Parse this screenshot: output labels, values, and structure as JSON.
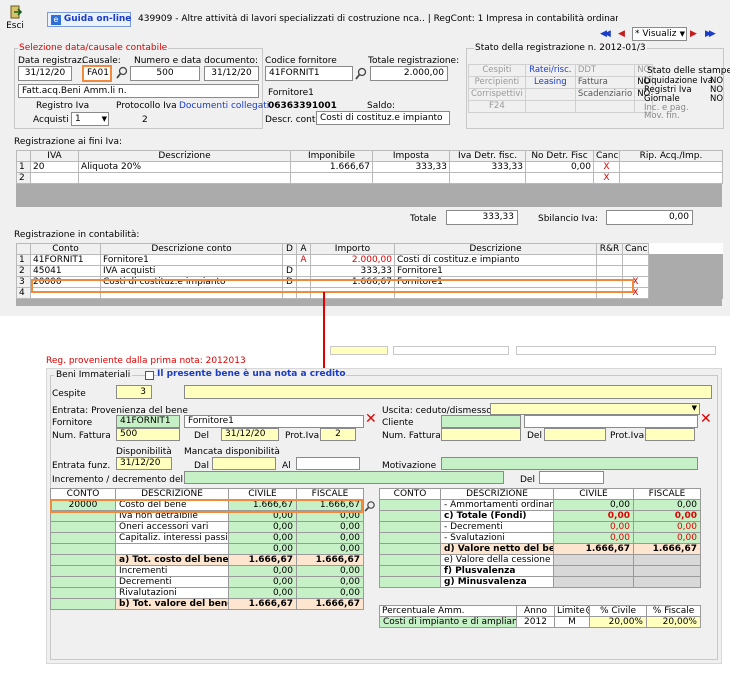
{
  "toolbar": {
    "esci": "Esci",
    "guida": "Guida on-line",
    "title": "439909 - Altre attività di lavori specializzati di costruzione nca.. | RegCont: 1 Impresa  in contabilità ordinaria..",
    "visualizza": "* Visualiz"
  },
  "selezione": {
    "legend": "Selezione data/causale contabile",
    "data_label": "Data registraz.",
    "causale_label": "Causale:",
    "numero_label": "Numero e data documento:",
    "data": "31/12/20",
    "causale": "FA01",
    "numero": "500",
    "data_doc": "31/12/20",
    "descrizione": "Fatt.acq.Beni Amm.li n.",
    "registro_label": "Registro Iva",
    "protocollo_label": "Protocollo Iva",
    "documenti_link": "Documenti collegati",
    "registro": "Acquisti",
    "registro_num": "1",
    "protocollo": "2"
  },
  "fornitore": {
    "codice_label": "Codice fornitore",
    "totale_label": "Totale registrazione:",
    "codice": "41FORNIT1",
    "totale": "2.000,00",
    "nome": "Fornitore1",
    "piva": "06363391001",
    "saldo_label": "Saldo:",
    "descr_label": "Descr. conto",
    "descr": "Costi di costituz.e impianto"
  },
  "stato": {
    "legend": "Stato della registrazione n. 2012-01/3",
    "rows": [
      [
        "Cespiti",
        "Ratei/risc.",
        "DDT",
        "NO"
      ],
      [
        "Percipienti",
        "Leasing",
        "Fattura",
        "NO"
      ],
      [
        "Corrispettivi",
        "",
        "Scadenziario",
        "NO"
      ],
      [
        "F24",
        "",
        "",
        ""
      ]
    ],
    "stampe_title": "Stato delle stampe:",
    "stampe": [
      [
        "Liquidazione Iva",
        "NO"
      ],
      [
        "Registri Iva",
        "NO"
      ],
      [
        "Giornale",
        "NO"
      ],
      [
        "Inc. e pag. Mov. fin.",
        ""
      ]
    ]
  },
  "iva": {
    "title": "Registrazione ai fini Iva:",
    "headers": [
      "IVA",
      "Descrizione",
      "Imponibile",
      "Imposta",
      "Iva Detr. fisc.",
      "No Detr. Fisc",
      "Canc",
      "Rip. Acq./Imp."
    ],
    "rows": [
      {
        "n": "1",
        "iva": "20",
        "descr": "Aliquota 20%",
        "imponibile": "1.666,67",
        "imposta": "333,33",
        "detr": "333,33",
        "nodetr": "0,00",
        "canc": "X"
      },
      {
        "n": "2",
        "iva": "",
        "descr": "",
        "imponibile": "",
        "imposta": "",
        "detr": "",
        "nodetr": "",
        "canc": "X"
      }
    ],
    "totale_label": "Totale",
    "totale": "333,33",
    "sbilancio_label": "Sbilancio Iva:",
    "sbilancio": "0,00"
  },
  "contabilita": {
    "title": "Registrazione in contabilità:",
    "headers": [
      "Conto",
      "Descrizione conto",
      "D",
      "A",
      "Importo",
      "Descrizione",
      "R&R",
      "Canc"
    ],
    "rows": [
      {
        "n": "1",
        "conto": "41FORNIT1",
        "descr": "Fornitore1",
        "d": "",
        "a": "A",
        "importo": "2.000,00",
        "descrizione": "Costi di costituz.e impianto",
        "canc": ""
      },
      {
        "n": "2",
        "conto": "45041",
        "descr": "IVA acquisti",
        "d": "D",
        "a": "",
        "importo": "333,33",
        "descrizione": "Fornitore1",
        "canc": ""
      },
      {
        "n": "3",
        "conto": "20000",
        "descr": "Costi di costituz.e impianto",
        "d": "D",
        "a": "",
        "importo": "1.666,67",
        "descrizione": "Fornitore1",
        "canc": "X"
      },
      {
        "n": "4",
        "conto": "",
        "descr": "",
        "d": "",
        "a": "",
        "importo": "",
        "descrizione": "",
        "canc": "X"
      }
    ]
  },
  "beni": {
    "provenienza": "Reg. proveniente dalla prima nota: 2012013",
    "group": "Beni Immateriali",
    "nota_credito": "Il presente bene è una nota a credito",
    "cespite_label": "Cespite",
    "cespite": "3",
    "entrata_title": "Entrata: Provenienza del bene",
    "fornitore_label": "Fornitore",
    "fornitore_code": "41FORNIT1",
    "fornitore_name": "Fornitore1",
    "numfatt_label": "Num. Fattura",
    "numfatt": "500",
    "del_label": "Del",
    "del": "31/12/20",
    "protiva_label": "Prot.Iva",
    "protiva": "2",
    "uscita_title": "Uscita: ceduto/dismesso",
    "cliente_label": "Cliente",
    "numfatt2_label": "Num. Fattura",
    "del2_label": "Del",
    "protiva2_label": "Prot.Iva",
    "disponibilita_label": "Disponibilità",
    "mancata_label": "Mancata disponibilità",
    "entrata_funz_label": "Entrata funz.",
    "entrata_funz": "31/12/20",
    "dal_label": "Dal",
    "al_label": "Al",
    "motivazione_label": "Motivazione",
    "incremento_label": "Incremento / decremento del bene -->",
    "del3_label": "Del"
  },
  "tab_sx": {
    "headers": [
      "CONTO",
      "DESCRIZIONE",
      "CIVILE",
      "FISCALE"
    ],
    "rows": [
      {
        "conto": "20000",
        "descr": "Costo del bene",
        "civile": "1.666,67",
        "fiscale": "1.666,67",
        "bold": false
      },
      {
        "conto": "",
        "descr": "Iva non detraibile",
        "civile": "0,00",
        "fiscale": "0,00",
        "bold": false
      },
      {
        "conto": "",
        "descr": "Oneri accessori vari",
        "civile": "0,00",
        "fiscale": "0,00",
        "bold": false
      },
      {
        "conto": "",
        "descr": "Capitaliz. interessi passiv",
        "civile": "0,00",
        "fiscale": "0,00",
        "bold": false
      },
      {
        "conto": "",
        "descr": "",
        "civile": "0,00",
        "fiscale": "0,00",
        "bold": false
      },
      {
        "conto": "",
        "descr": "a) Tot. costo del bene",
        "civile": "1.666,67",
        "fiscale": "1.666,67",
        "bold": true
      },
      {
        "conto": "",
        "descr": "Incrementi",
        "civile": "0,00",
        "fiscale": "0,00",
        "bold": false
      },
      {
        "conto": "",
        "descr": "Decrementi",
        "civile": "0,00",
        "fiscale": "0,00",
        "bold": false
      },
      {
        "conto": "",
        "descr": "Rivalutazioni",
        "civile": "0,00",
        "fiscale": "0,00",
        "bold": false
      },
      {
        "conto": "",
        "descr": "b) Tot. valore del bene",
        "civile": "1.666,67",
        "fiscale": "1.666,67",
        "bold": true
      }
    ]
  },
  "tab_dx": {
    "headers": [
      "CONTO",
      "DESCRIZIONE",
      "CIVILE",
      "FISCALE"
    ],
    "rows": [
      {
        "descr": "- Ammortamenti ordinari",
        "civile": "0,00",
        "fiscale": "0,00",
        "bold": false,
        "red": false
      },
      {
        "descr": "c) Totale (Fondi)",
        "civile": "0,00",
        "fiscale": "0,00",
        "bold": true,
        "red": true
      },
      {
        "descr": "- Decrementi",
        "civile": "0,00",
        "fiscale": "0,00",
        "bold": false,
        "red": true
      },
      {
        "descr": "- Svalutazioni",
        "civile": "0,00",
        "fiscale": "0,00",
        "bold": false,
        "red": true
      },
      {
        "descr": "d) Valore netto del bene",
        "civile": "1.666,67",
        "fiscale": "1.666,67",
        "bold": true,
        "red": false
      },
      {
        "descr": "e) Valore della cessione",
        "civile": "",
        "fiscale": "",
        "bold": false,
        "red": false
      },
      {
        "descr": "f) Plusvalenza",
        "civile": "",
        "fiscale": "",
        "bold": true,
        "red": false
      },
      {
        "descr": "g) Minusvalenza",
        "civile": "",
        "fiscale": "",
        "bold": true,
        "red": false
      }
    ]
  },
  "percentuale": {
    "headers": [
      "Percentuale Amm.",
      "Anno",
      "Limite",
      "% Civile",
      "% Fiscale"
    ],
    "row": [
      "Costi di impianto e di ampliam",
      "2012",
      "M",
      "20,00%",
      "20,00%"
    ]
  }
}
